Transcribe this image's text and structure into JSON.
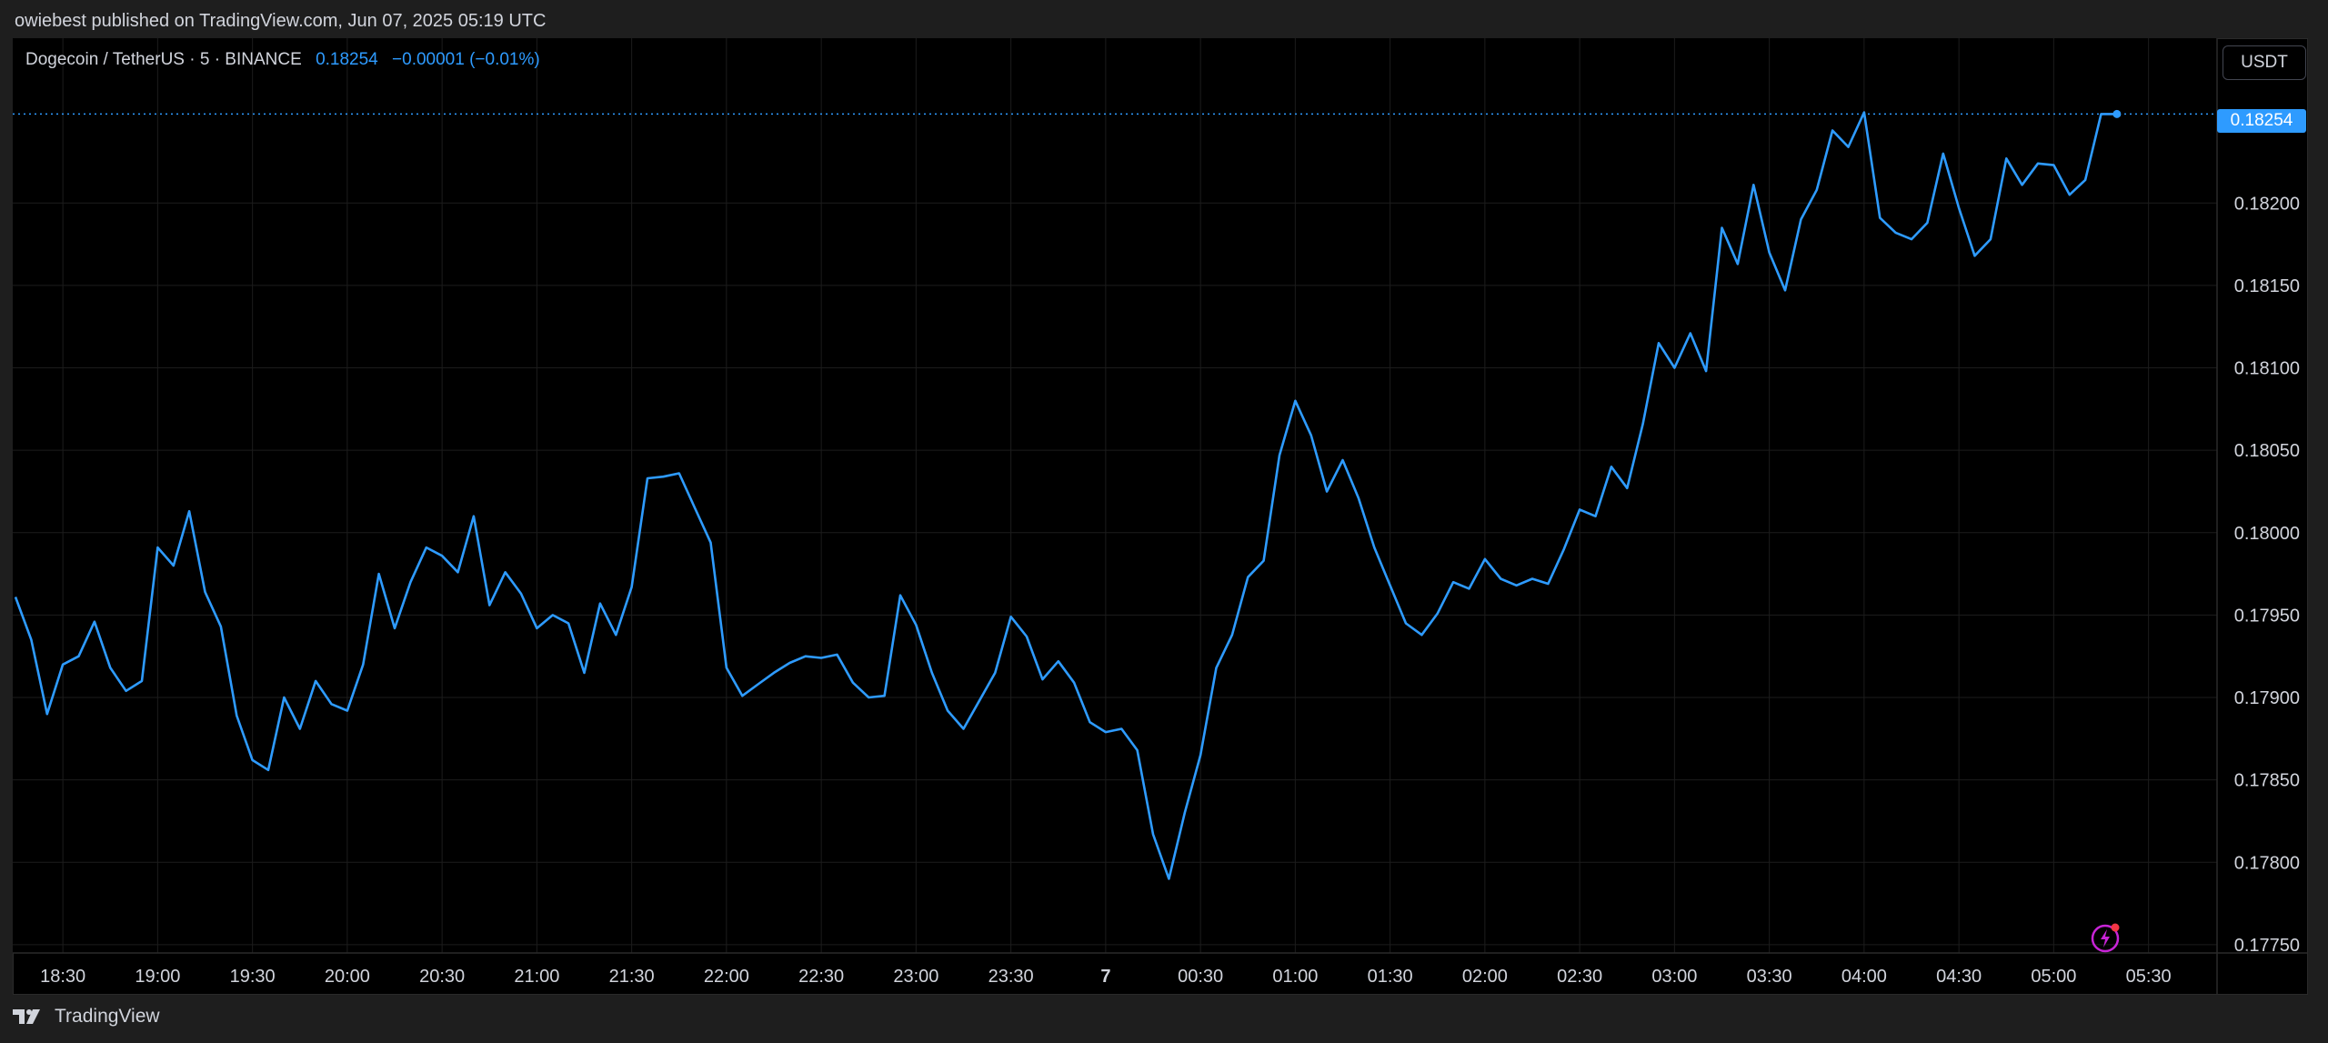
{
  "header": {
    "published_text": "owiebest published on TradingView.com, Jun 07, 2025 05:19 UTC"
  },
  "legend": {
    "symbol": "Dogecoin / TetherUS · 5 · BINANCE",
    "price": "0.18254",
    "change": "−0.00001 (−0.01%)"
  },
  "currency_button": "USDT",
  "last_price_badge": "0.18254",
  "footer": {
    "brand": "TradingView"
  },
  "colors": {
    "line": "#2e9bff",
    "background": "#000000",
    "grid": "#1c1c1c",
    "text": "#d1d4dc"
  },
  "icons": {
    "brand": "tradingview-logo-icon",
    "alert": "lightning-icon"
  },
  "chart_data": {
    "type": "line",
    "title": "",
    "xlabel": "",
    "ylabel": "",
    "series": [
      {
        "values": [
          0.17961,
          0.17935,
          0.1789,
          0.1792,
          0.17925,
          0.17946,
          0.17918,
          0.17904,
          0.1791,
          0.17991,
          0.1798,
          0.18013,
          0.17964,
          0.17943,
          0.17889,
          0.17862,
          0.17856,
          0.179,
          0.17881,
          0.1791,
          0.17896,
          0.17892,
          0.1792,
          0.17975,
          0.17942,
          0.1797,
          0.17991,
          0.17986,
          0.17976,
          0.1801,
          0.17956,
          0.17976,
          0.17963,
          0.17942,
          0.1795,
          0.17945,
          0.17915,
          0.17957,
          0.17938,
          0.17967,
          0.18033,
          0.18034,
          0.18036,
          0.18015,
          0.17994,
          0.17918,
          0.17901,
          0.17908,
          0.17915,
          0.17921,
          0.17925,
          0.17924,
          0.17926,
          0.17909,
          0.179,
          0.17901,
          0.17962,
          0.17944,
          0.17915,
          0.17892,
          0.17881,
          0.17898,
          0.17915,
          0.17949,
          0.17937,
          0.17911,
          0.17922,
          0.17909,
          0.17885,
          0.17879,
          0.17881,
          0.17868,
          0.17817,
          0.1779,
          0.1783,
          0.17865,
          0.17918,
          0.17938,
          0.17973,
          0.17983,
          0.18047,
          0.1808,
          0.18059,
          0.18025,
          0.18044,
          0.18021,
          0.17991,
          0.17968,
          0.17945,
          0.17938,
          0.17951,
          0.1797,
          0.17966,
          0.17984,
          0.17972,
          0.17968,
          0.17972,
          0.17969,
          0.1799,
          0.18014,
          0.1801,
          0.1804,
          0.18027,
          0.18066,
          0.18115,
          0.181,
          0.18121,
          0.18098,
          0.18185,
          0.18163,
          0.18211,
          0.1817,
          0.18147,
          0.1819,
          0.18208,
          0.18244,
          0.18234,
          0.18255,
          0.18191,
          0.18182,
          0.18178,
          0.18188,
          0.1823,
          0.18197,
          0.18168,
          0.18178,
          0.18227,
          0.18211,
          0.18224,
          0.18223,
          0.18205,
          0.18214,
          0.18254,
          0.18254
        ]
      }
    ],
    "x_start_time": "18:15",
    "x_interval": "5 min",
    "x_ticks": [
      "18:30",
      "19:00",
      "19:30",
      "20:00",
      "20:30",
      "21:00",
      "21:30",
      "22:00",
      "22:30",
      "23:00",
      "23:30",
      "7",
      "00:30",
      "01:00",
      "01:30",
      "02:00",
      "02:30",
      "03:00",
      "03:30",
      "04:00",
      "04:30",
      "05:00",
      "05:30"
    ],
    "y_ticks": [
      "0.18200",
      "0.18150",
      "0.18100",
      "0.18050",
      "0.18000",
      "0.17950",
      "0.17900",
      "0.17850",
      "0.17800",
      "0.17750"
    ],
    "ylim": [
      0.17745,
      0.183
    ],
    "last_value": 0.18254,
    "grid": true,
    "y_axis_position": "right"
  }
}
